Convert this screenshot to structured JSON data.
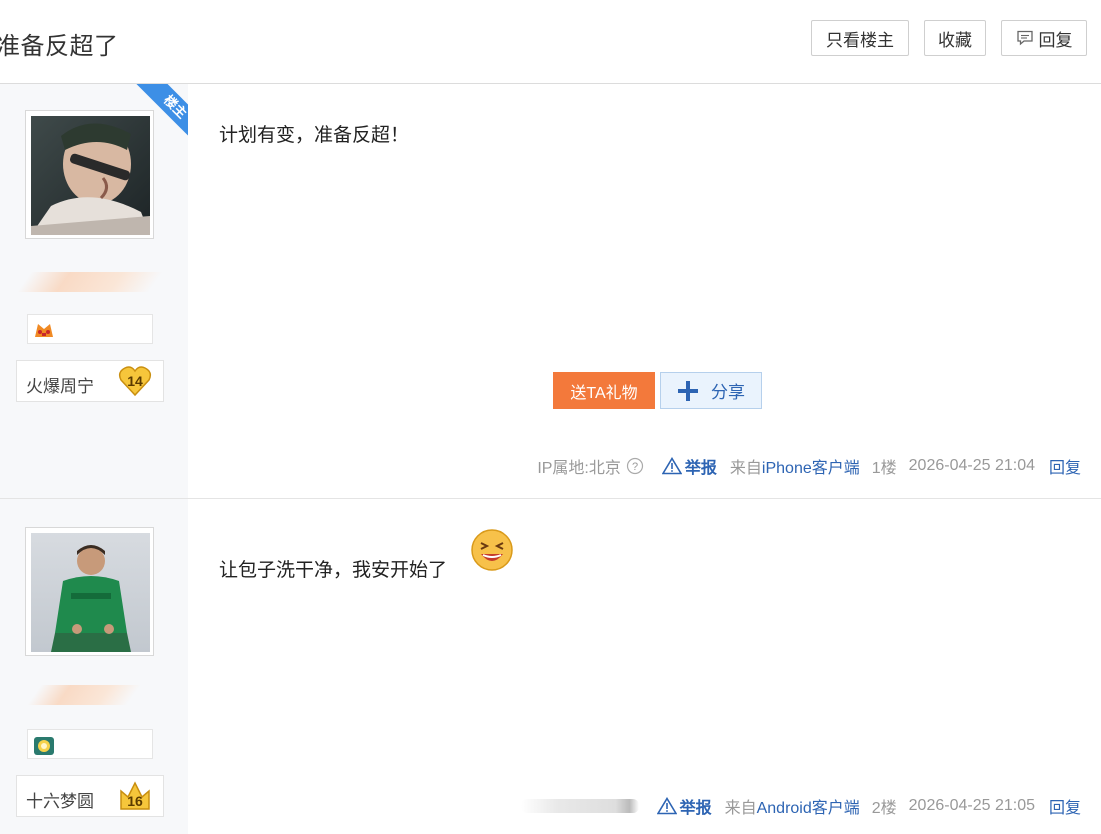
{
  "header": {
    "title": "准备反超了",
    "only_owner_label": "只看楼主",
    "favorite_label": "收藏",
    "reply_label": "回复"
  },
  "posts": [
    {
      "is_owner": true,
      "owner_tag": "楼主",
      "username": "火爆周宁",
      "level": "14",
      "content": "计划有变，准备反超！",
      "gift_label": "送TA礼物",
      "share_label": "分享",
      "ip_label": "IP属地:北京",
      "report_label": "举报",
      "from_prefix": "来自",
      "client": "iPhone客户端",
      "floor": "1楼",
      "time": "2026-04-25 21:04",
      "reply_label": "回复"
    },
    {
      "is_owner": false,
      "username": "十六梦圆",
      "level": "16",
      "content": "让包子洗干净，我安开始了",
      "report_label": "举报",
      "from_prefix": "来自",
      "client": "Android客户端",
      "floor": "2楼",
      "time": "2026-04-25 21:05",
      "reply_label": "回复"
    }
  ],
  "colors": {
    "link_blue": "#2d64b3",
    "gift_orange": "#f3793b",
    "owner_ribbon": "#3d8fe6",
    "sidebar_bg": "#f7f8fa"
  },
  "icons": {
    "reply": "comment-bubble-icon",
    "report": "warning-triangle-icon",
    "share": "plus-share-icon",
    "ip_help": "question-circle-icon"
  }
}
